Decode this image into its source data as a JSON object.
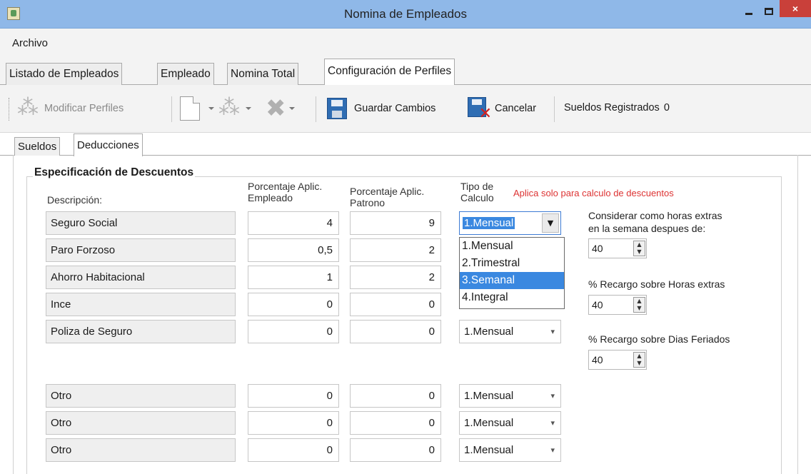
{
  "window": {
    "title": "Nomina de Empleados",
    "close_glyph": "×"
  },
  "menu": {
    "items": [
      "Archivo"
    ]
  },
  "main_tabs": [
    {
      "label": "Listado de Empleados",
      "active": false
    },
    {
      "label": "Empleado",
      "active": false
    },
    {
      "label": "Nomina Total",
      "active": false
    },
    {
      "label": "Configuración de Perfiles",
      "active": true
    }
  ],
  "toolbar": {
    "modify_label": "Modificar Perfiles",
    "save_label": "Guardar Cambios",
    "cancel_label": "Cancelar",
    "registered_label": "Sueldos Registrados",
    "registered_count": "0"
  },
  "sub_tabs": [
    {
      "label": "Sueldos",
      "active": false
    },
    {
      "label": "Deducciones",
      "active": true
    }
  ],
  "group": {
    "title": "Especificación de Descuentos",
    "col_desc": "Descripción:",
    "col_emp": [
      "Porcentaje Aplic.",
      "Empleado"
    ],
    "col_pat": [
      "Porcentaje Aplic.",
      "Patrono"
    ],
    "col_tipo": [
      "Tipo de",
      "Calculo"
    ],
    "note": "Aplica solo para calculo de descuentos"
  },
  "rows": [
    {
      "desc": "Seguro Social",
      "emp": "4",
      "pat": "9",
      "tipo": "1.Mensual"
    },
    {
      "desc": "Paro Forzoso",
      "emp": "0,5",
      "pat": "2",
      "tipo": "1.Mensual"
    },
    {
      "desc": "Ahorro Habitacional",
      "emp": "1",
      "pat": "2",
      "tipo": "1.Mensual"
    },
    {
      "desc": "Ince",
      "emp": "0",
      "pat": "0",
      "tipo": "1.Mensual"
    },
    {
      "desc": "Poliza de Seguro",
      "emp": "0",
      "pat": "0",
      "tipo": "1.Mensual"
    },
    {
      "desc": "Otro",
      "emp": "0",
      "pat": "0",
      "tipo": "1.Mensual"
    },
    {
      "desc": "Otro",
      "emp": "0",
      "pat": "0",
      "tipo": "1.Mensual"
    },
    {
      "desc": "Otro",
      "emp": "0",
      "pat": "0",
      "tipo": "1.Mensual"
    }
  ],
  "dropdown_options": [
    "1.Mensual",
    "2.Trimestral",
    "3.Semanal",
    "4.Integral"
  ],
  "dropdown_highlighted": "3.Semanal",
  "side": {
    "overtime_label": [
      "Considerar como horas extras",
      "en la semana despues de:"
    ],
    "overtime_value": "40",
    "surcharge_overtime_label": "% Recargo sobre Horas extras",
    "surcharge_overtime_value": "40",
    "surcharge_holiday_label": "% Recargo sobre Dias Feriados",
    "surcharge_holiday_value": "40"
  },
  "icons": {
    "arrow_down": "▾",
    "arrow_down_bold": "▼",
    "spin_up": "▲",
    "spin_down": "▼",
    "delete_glyph": "✖",
    "cancel_glyph": "✕"
  }
}
